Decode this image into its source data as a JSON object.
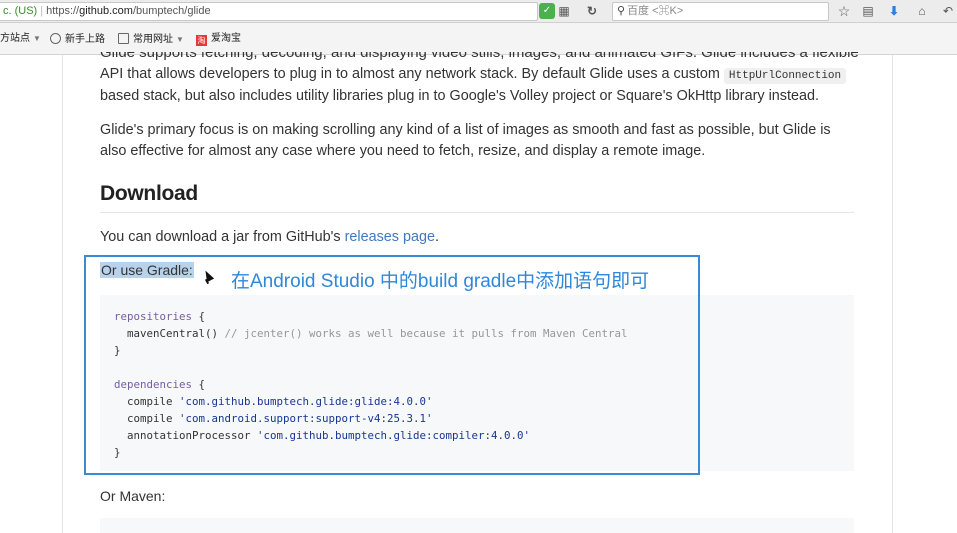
{
  "browser": {
    "url_prefix": "c. (US)",
    "url_scheme": "https://",
    "url_host": "github.com",
    "url_path": "/bumptech/glide",
    "search_placeholder": "百度 <⌘K>",
    "icons": [
      "shield-icon",
      "qr-icon",
      "reload-icon",
      "search-icon",
      "star-icon",
      "reader-icon",
      "download-icon",
      "home-icon",
      "back-icon"
    ]
  },
  "bookmarks": {
    "items": [
      {
        "label": "方站点",
        "has_caret": true
      },
      {
        "label": "新手上路",
        "icon": "gear-icon"
      },
      {
        "label": "常用网址",
        "icon": "folder-icon",
        "has_caret": true
      },
      {
        "label": "爱淘宝",
        "icon": "taobao-icon"
      }
    ]
  },
  "article": {
    "p1_cut": "Glide supports fetching, decoding, and displaying video stills, images, and animated GIFs. Glide includes a flexible",
    "p1_line2_a": "API that allows developers to plug in to almost any network stack. By default Glide uses a custom ",
    "p1_code": "HttpUrlConnection",
    "p1_line3": "based stack, but also includes utility libraries plug in to Google's Volley project or Square's OkHttp library instead.",
    "p2_line1": "Glide's primary focus is on making scrolling any kind of a list of images as smooth and fast as possible, but Glide is",
    "p2_line2": "also effective for almost any case where you need to fetch, resize, and display a remote image.",
    "download_heading": "Download",
    "download_text_a": "You can download a jar from GitHub's ",
    "download_link": "releases page",
    "download_text_b": ".",
    "gradle_label": "Or use Gradle:",
    "code": {
      "l1_kw": "repositories",
      "l1_rest": " {",
      "l2_a": "  mavenCentral() ",
      "l2_cm": "// jcenter() works as well because it pulls from Maven Central",
      "l3": "}",
      "l5_kw": "dependencies",
      "l5_rest": " {",
      "l6_a": "  compile ",
      "l6_str": "'com.github.bumptech.glide:glide:4.0.0'",
      "l7_a": "  compile ",
      "l7_str": "'com.android.support:support-v4:25.3.1'",
      "l8_a": "  annotationProcessor ",
      "l8_str": "'com.github.bumptech.glide:compiler:4.0.0'",
      "l9": "}"
    },
    "maven_label": "Or Maven:"
  },
  "annotation": {
    "text": "在Android Studio 中的build gradle中添加语句即可",
    "color": "#2f87d9"
  }
}
